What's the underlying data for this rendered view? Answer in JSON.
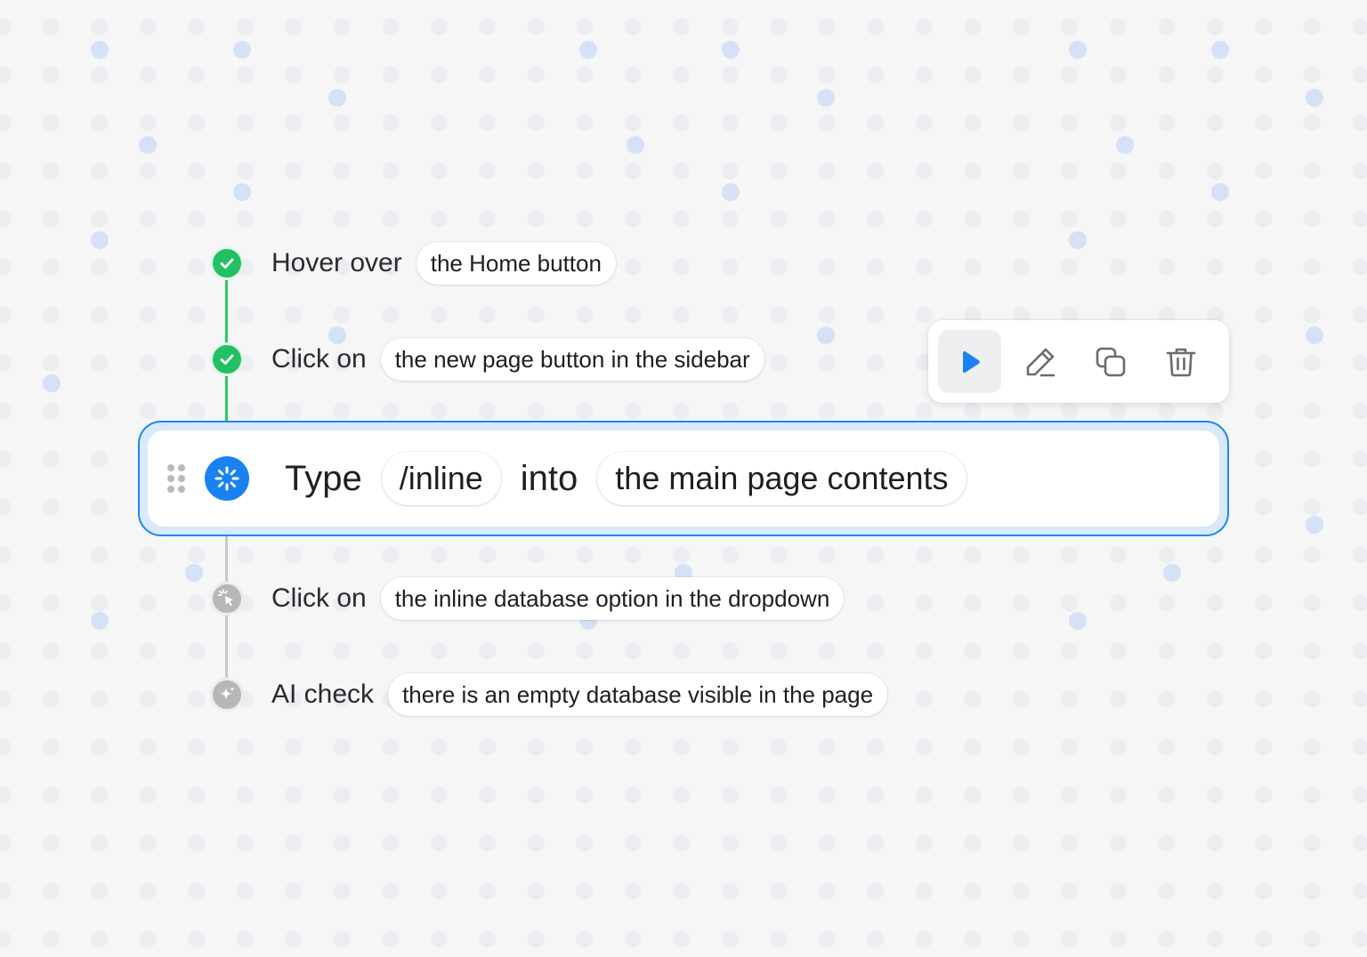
{
  "steps": [
    {
      "action": "Hover over",
      "target": "the Home button",
      "status": "done",
      "icon": "check-icon"
    },
    {
      "action": "Click on",
      "target": "the new page button in the sidebar",
      "status": "done",
      "icon": "check-icon"
    },
    {
      "action": "Click on",
      "target": "the inline database option in the dropdown",
      "status": "pending",
      "icon": "cursor-click-icon"
    },
    {
      "action": "AI check",
      "target": "there is an empty database visible in the page",
      "status": "pending",
      "icon": "sparkle-icon"
    }
  ],
  "active_step": {
    "action": "Type",
    "value": "/inline",
    "connector": "into",
    "target": "the main page contents",
    "status": "running",
    "icon": "spinner-icon"
  },
  "toolbar": {
    "buttons": [
      {
        "name": "play",
        "icon": "play-icon",
        "active": true
      },
      {
        "name": "edit",
        "icon": "pencil-icon",
        "active": false
      },
      {
        "name": "duplicate",
        "icon": "copy-icon",
        "active": false
      },
      {
        "name": "delete",
        "icon": "trash-icon",
        "active": false
      }
    ]
  },
  "colors": {
    "done": "#23c063",
    "running": "#1a82f0",
    "pending": "#b7b7ba",
    "accent_border": "#1e88ee"
  }
}
